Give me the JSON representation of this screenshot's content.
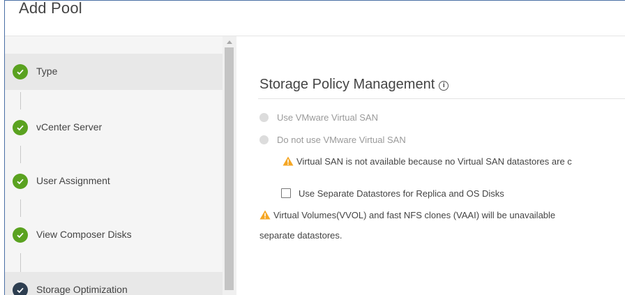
{
  "dialog": {
    "title": "Add Pool"
  },
  "sidebar": {
    "steps": [
      {
        "label": "Type",
        "state": "done"
      },
      {
        "label": "vCenter Server",
        "state": "done"
      },
      {
        "label": "User Assignment",
        "state": "done"
      },
      {
        "label": "View Composer Disks",
        "state": "done"
      },
      {
        "label": "Storage Optimization",
        "state": "current"
      }
    ]
  },
  "content": {
    "section_title": "Storage Policy Management",
    "radio_use_vsan": "Use VMware Virtual SAN",
    "radio_no_vsan": "Do not use VMware Virtual SAN",
    "warning_vsan": "Virtual SAN is not available because no Virtual SAN datastores are c",
    "checkbox_separate": "Use Separate Datastores for Replica and OS Disks",
    "warning_vvol_line1": "Virtual Volumes(VVOL) and fast NFS clones (VAAI) will be unavailable",
    "warning_vvol_line2": "separate datastores."
  },
  "colors": {
    "success": "#5aa220",
    "current": "#2d3e50",
    "warning": "#f5a623"
  }
}
